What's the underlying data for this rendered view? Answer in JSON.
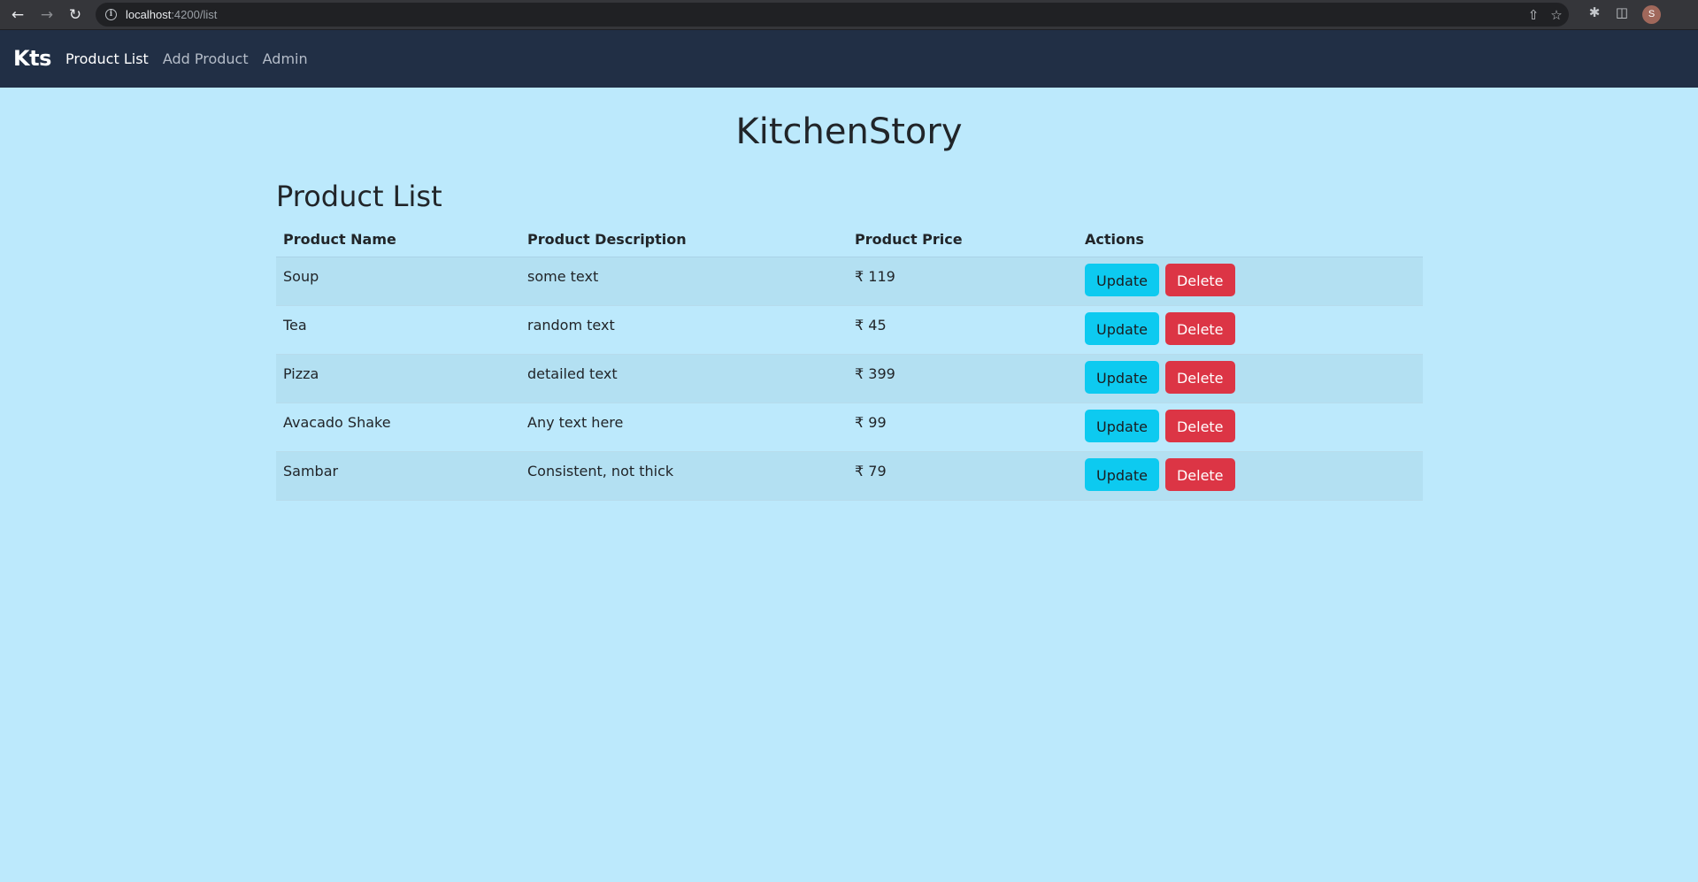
{
  "browser": {
    "url_host": "localhost",
    "url_path": ":4200/list",
    "profile_initial": "S"
  },
  "navbar": {
    "brand": "Kts",
    "links": [
      {
        "label": "Product List",
        "active": true
      },
      {
        "label": "Add Product",
        "active": false
      },
      {
        "label": "Admin",
        "active": false
      }
    ]
  },
  "main": {
    "title": "KitchenStory",
    "section_title": "Product List",
    "table": {
      "headers": [
        "Product Name",
        "Product Description",
        "Product Price",
        "Actions"
      ],
      "rows": [
        {
          "name": "Soup",
          "description": "some text",
          "price": "₹ 119"
        },
        {
          "name": "Tea",
          "description": "random text",
          "price": "₹ 45"
        },
        {
          "name": "Pizza",
          "description": "detailed text",
          "price": "₹ 399"
        },
        {
          "name": "Avacado Shake",
          "description": "Any text here",
          "price": "₹ 99"
        },
        {
          "name": "Sambar",
          "description": "Consistent, not thick",
          "price": "₹ 79"
        }
      ],
      "update_label": "Update",
      "delete_label": "Delete"
    }
  },
  "colors": {
    "page_bg": "#bce9fc",
    "navbar_bg": "#212f45",
    "update_btn": "#0dcaf0",
    "delete_btn": "#dc3545"
  }
}
